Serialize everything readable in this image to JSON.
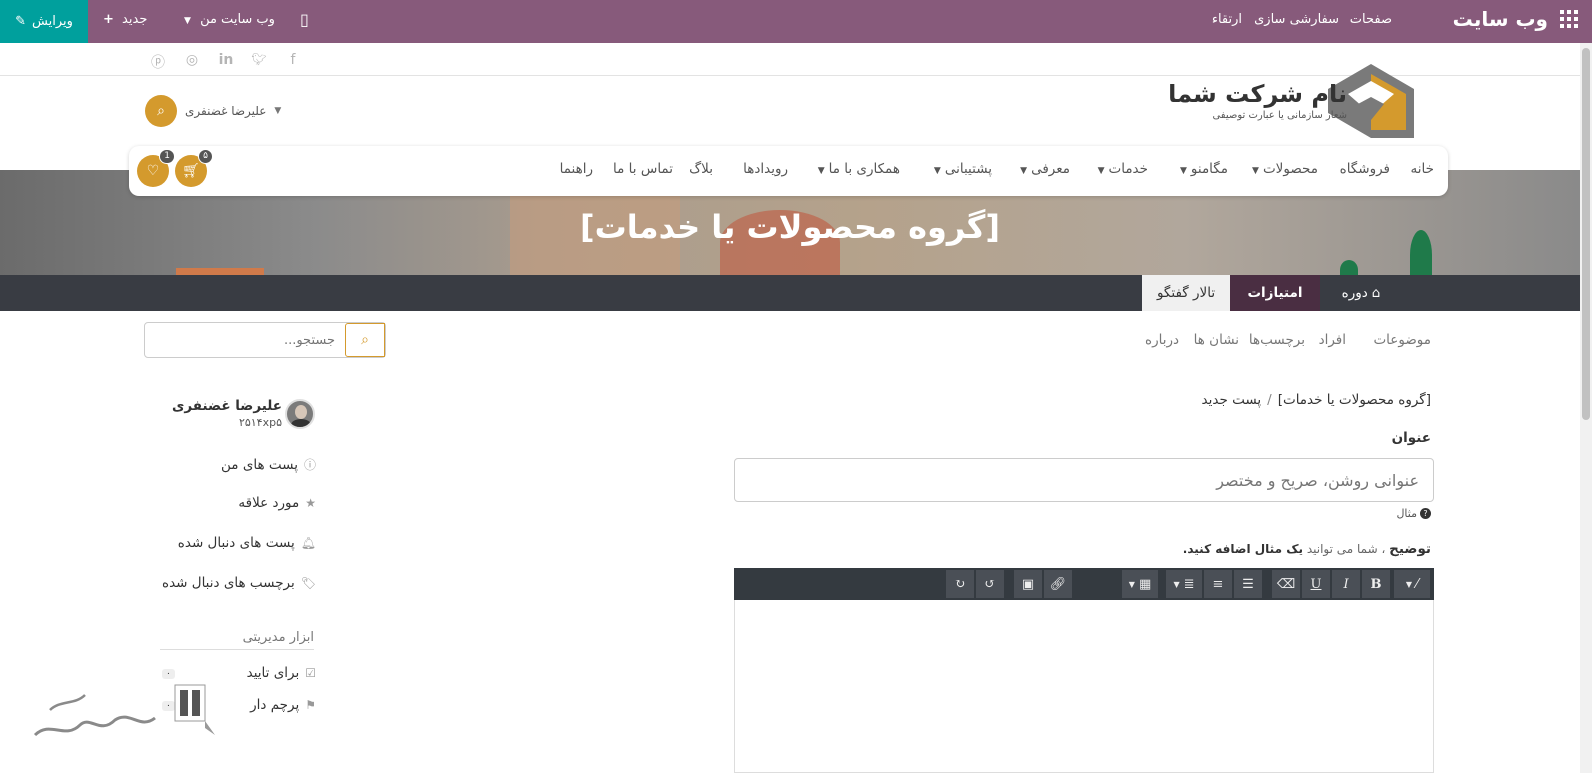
{
  "topbar": {
    "brand": "وب سایت",
    "menu": [
      "صفحات",
      "سفارشی سازی",
      "ارتقاء"
    ],
    "my_website": "وب سایت من",
    "new_label": "جدید",
    "edit_label": "ویرایش",
    "bg_color": "#875a7b",
    "edit_color": "#00a09d"
  },
  "social": [
    "facebook-icon",
    "twitter-icon",
    "linkedin-icon",
    "instagram-icon",
    "pinterest-icon"
  ],
  "header": {
    "company_name": "نام شرکت شما",
    "slogan": "شعار سازمانی یا عبارت توصیفی",
    "user_name": "علیرضا غضنفری"
  },
  "nav": {
    "items": [
      {
        "label": "خانه",
        "dropdown": false
      },
      {
        "label": "فروشگاه",
        "dropdown": false
      },
      {
        "label": "محصولات",
        "dropdown": true
      },
      {
        "label": "مگامنو",
        "dropdown": true
      },
      {
        "label": "خدمات",
        "dropdown": true
      },
      {
        "label": "معرفی",
        "dropdown": true
      },
      {
        "label": "پشتیبانی",
        "dropdown": true
      },
      {
        "label": "همکاری با ما",
        "dropdown": true
      },
      {
        "label": "رویدادها",
        "dropdown": false
      },
      {
        "label": "بلاگ",
        "dropdown": false
      },
      {
        "label": "تماس با ما",
        "dropdown": false
      },
      {
        "label": "راهنما",
        "dropdown": false
      }
    ],
    "cart_count": "۵",
    "wishlist_count": "1",
    "accent_color": "#d49a2d"
  },
  "hero": {
    "title": "[گروه محصولات یا خدمات]"
  },
  "forum_tabs": {
    "course": "دوره",
    "karma": "امتیازات",
    "forum": "تالار گفتگو"
  },
  "subnav": {
    "links": [
      "موضوعات",
      "افراد",
      "برچسب‌ها",
      "نشان ها",
      "درباره"
    ],
    "search_placeholder": "جستجو..."
  },
  "breadcrumb": {
    "parent": "[گروه محصولات یا خدمات]",
    "sep": "/",
    "current": "پست جدید"
  },
  "form": {
    "title_label": "عنوان",
    "title_placeholder": "عنوانی روشن، صریح و مختصر",
    "example_hint": "مثال",
    "desc_label": "توضیح",
    "desc_note_pre": "، شما می توانید",
    "desc_note_bold": "یک مثال اضافه کنید."
  },
  "sidebar": {
    "profile_name": "علیرضا غضنفری",
    "profile_xp": "۲۵۱۴xp۵",
    "links": [
      "پست های من",
      "مورد علاقه",
      "پست های دنبال شده",
      "برچسب های دنبال شده"
    ],
    "admin_heading": "ابزار مدیریتی",
    "admin_links": [
      {
        "label": "برای تایید",
        "count": "۰"
      },
      {
        "label": "پرچم دار",
        "count": "۰"
      }
    ]
  }
}
